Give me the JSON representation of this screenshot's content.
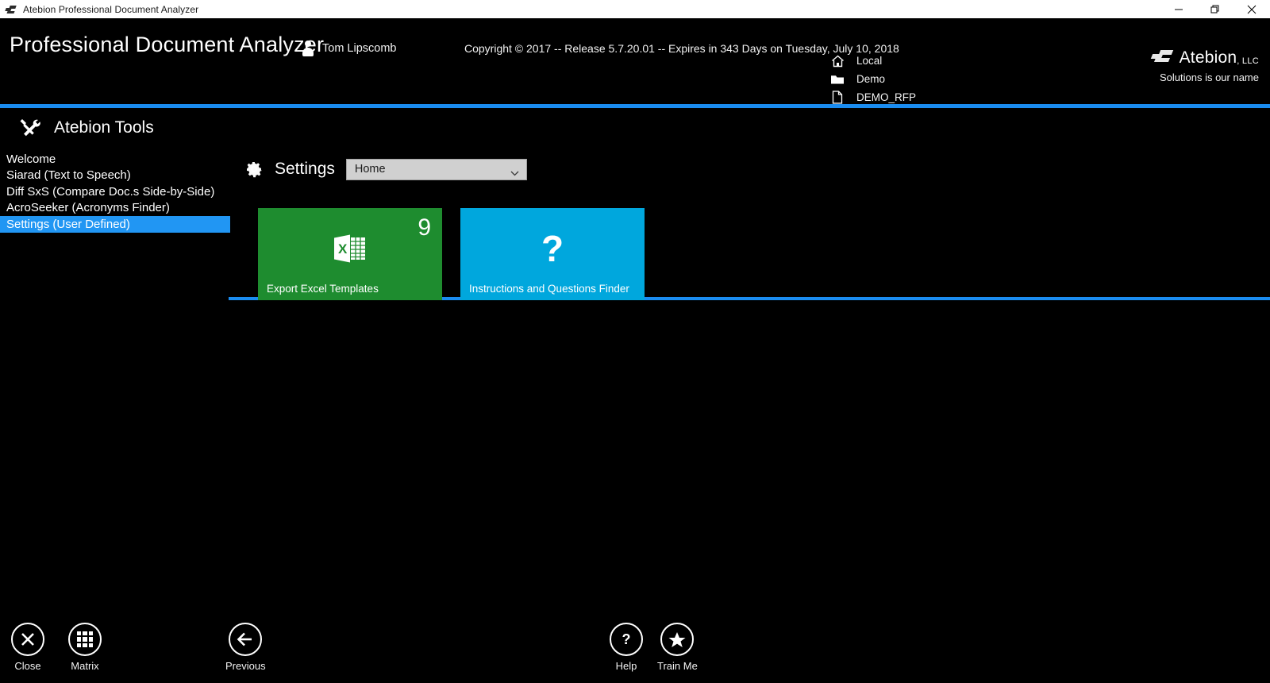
{
  "window": {
    "title": "Atebion Professional Document Analyzer",
    "icon": "atebion-logo-icon",
    "controls": {
      "minimize": "minimize-icon",
      "restore": "restore-icon",
      "close": "close-icon"
    }
  },
  "header": {
    "app_title": "Professional Document Analyzer",
    "user": {
      "icon": "person-icon",
      "name": "Tom Lipscomb"
    },
    "copyright": "Copyright © 2017 -- Release 5.7.20.01 -- Expires in 343 Days on Tuesday, July 10, 2018",
    "context": [
      {
        "icon": "home-icon",
        "label": "Local"
      },
      {
        "icon": "folder-icon",
        "label": "Demo"
      },
      {
        "icon": "document-icon",
        "label": "DEMO_RFP"
      }
    ],
    "brand": {
      "mark": "atebion-logo-icon",
      "name": "Atebion",
      "suffix": ", LLC",
      "tagline": "Solutions is our name"
    },
    "accent_color": "#1a8cf0"
  },
  "sidebar": {
    "icon": "tools-icon",
    "title": "Atebion Tools",
    "items": [
      {
        "label": "Welcome",
        "selected": false
      },
      {
        "label": "Siarad (Text to Speech)",
        "selected": false
      },
      {
        "label": "Diff SxS (Compare Doc.s Side-by-Side)",
        "selected": false
      },
      {
        "label": "AcroSeeker (Acronyms Finder)",
        "selected": false
      },
      {
        "label": "Settings (User Defined)",
        "selected": true
      }
    ],
    "selection_color": "#2196f3"
  },
  "main": {
    "section_icon": "gear-icon",
    "section_title": "Settings",
    "scope_select": {
      "value": "Home",
      "chevron": "chevron-down-icon"
    },
    "tiles": [
      {
        "label": "Export Excel Templates",
        "badge": "9",
        "icon": "excel-icon",
        "color": "#1e8c2f"
      },
      {
        "label": "Instructions and Questions Finder",
        "badge": "",
        "icon": "question-mark-icon",
        "color": "#00a7dd"
      }
    ]
  },
  "toolbar": {
    "buttons": [
      {
        "label": "Close",
        "icon": "close-x-icon"
      },
      {
        "label": "Matrix",
        "icon": "grid-icon"
      },
      {
        "label": "Previous",
        "icon": "arrow-left-icon"
      },
      {
        "label": "Help",
        "icon": "question-icon"
      },
      {
        "label": "Train Me",
        "icon": "star-icon"
      }
    ]
  }
}
